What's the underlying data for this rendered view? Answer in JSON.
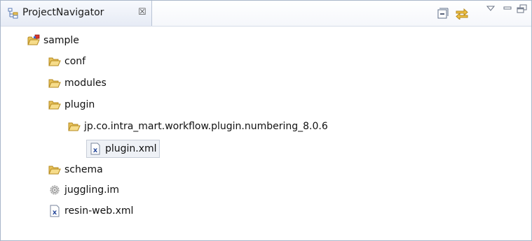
{
  "view": {
    "title": "ProjectNavigator",
    "close_glyph": "☒"
  },
  "toolbar": {
    "buttons": [
      {
        "name": "collapse-all-icon"
      },
      {
        "name": "link-with-editor-icon"
      },
      {
        "name": "view-menu-icon"
      },
      {
        "name": "minimize-icon"
      },
      {
        "name": "maximize-icon"
      }
    ]
  },
  "tree": {
    "items": [
      {
        "label": "sample",
        "icon": "project-folder-icon",
        "depth": 0
      },
      {
        "label": "conf",
        "icon": "folder-icon",
        "depth": 1
      },
      {
        "label": "modules",
        "icon": "folder-icon",
        "depth": 1
      },
      {
        "label": "plugin",
        "icon": "folder-icon",
        "depth": 1
      },
      {
        "label": "jp.co.intra_mart.workflow.plugin.numbering_8.0.6",
        "icon": "folder-icon",
        "depth": 2
      },
      {
        "label": "plugin.xml",
        "icon": "xml-file-icon",
        "depth": 3,
        "selected": true
      },
      {
        "label": "schema",
        "icon": "folder-icon",
        "depth": 1
      },
      {
        "label": "juggling.im",
        "icon": "settings-file-icon",
        "depth": 1
      },
      {
        "label": "resin-web.xml",
        "icon": "xml-file-icon",
        "depth": 1
      }
    ]
  },
  "colors": {
    "folder": "#e8c25a",
    "folder_dark": "#b58a1f",
    "xml_blue": "#2c4d9c",
    "selection": "#eef1f6"
  }
}
